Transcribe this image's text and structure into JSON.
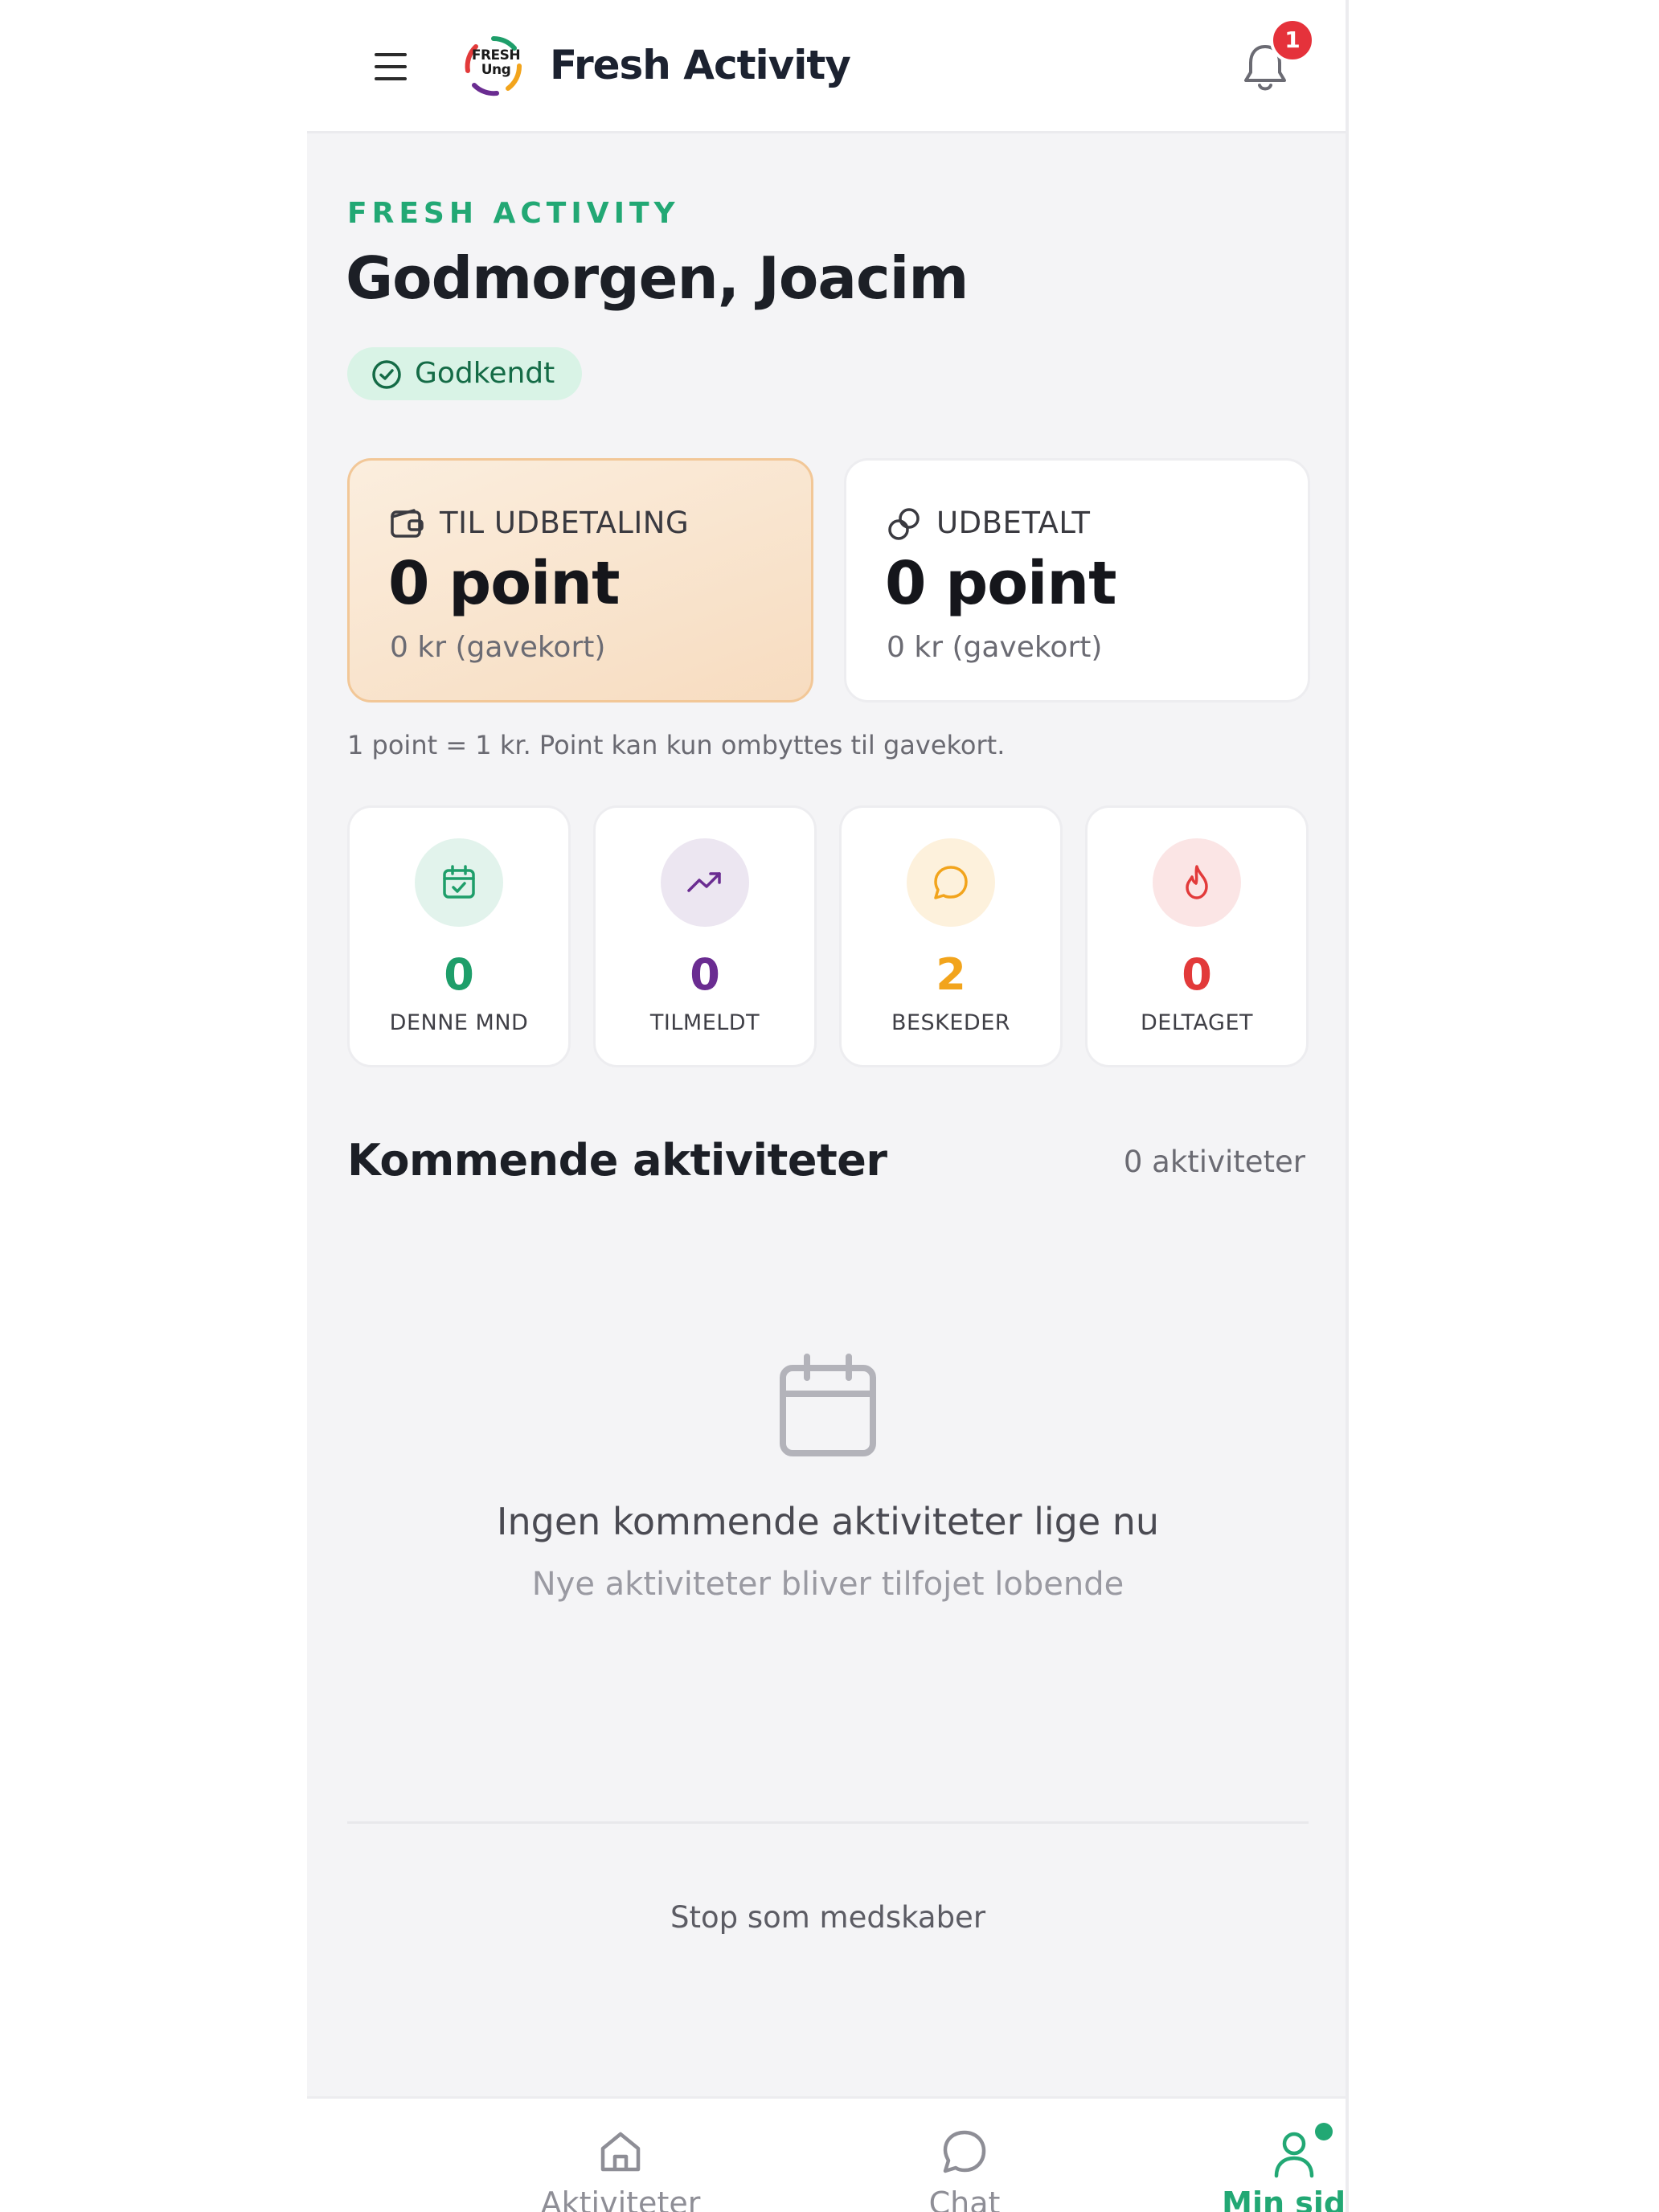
{
  "header": {
    "logo_text_line1": "FRESH",
    "logo_text_line2": "Ung",
    "brand": "Fresh Activity",
    "notification_count": "1"
  },
  "intro": {
    "eyebrow": "FRESH ACTIVITY",
    "greeting": "Godmorgen, Joacim",
    "status": "Godkendt"
  },
  "points": {
    "pending": {
      "label": "TIL UDBETALING",
      "value": "0 point",
      "sub": "0 kr (gavekort)"
    },
    "paid": {
      "label": "UDBETALT",
      "value": "0 point",
      "sub": "0 kr (gavekort)"
    },
    "note": "1 point = 1 kr. Point kan kun ombyttes til gavekort."
  },
  "stats": [
    {
      "value": "0",
      "label": "DENNE MND",
      "icon": "calendar-check-icon",
      "color": "#1e9e6a",
      "bg": "#e2f3ec"
    },
    {
      "value": "0",
      "label": "TILMELDT",
      "icon": "trending-up-icon",
      "color": "#6a2c91",
      "bg": "#ece6f1"
    },
    {
      "value": "2",
      "label": "BESKEDER",
      "icon": "chat-bubble-icon",
      "color": "#f2a41c",
      "bg": "#fdf1dc"
    },
    {
      "value": "0",
      "label": "DELTAGET",
      "icon": "flame-icon",
      "color": "#e23a3a",
      "bg": "#fbe5e5"
    }
  ],
  "upcoming": {
    "title": "Kommende aktiviteter",
    "count": "0 aktiviteter",
    "empty_title": "Ingen kommende aktiviteter lige nu",
    "empty_sub": "Nye aktiviteter bliver tilfojet lobende"
  },
  "footer_link": "Stop som medskaber",
  "nav": {
    "activities": "Aktiviteter",
    "chat": "Chat",
    "mine": "Min side"
  },
  "colors": {
    "accent_green": "#22a874",
    "badge_red": "#e5323b"
  }
}
